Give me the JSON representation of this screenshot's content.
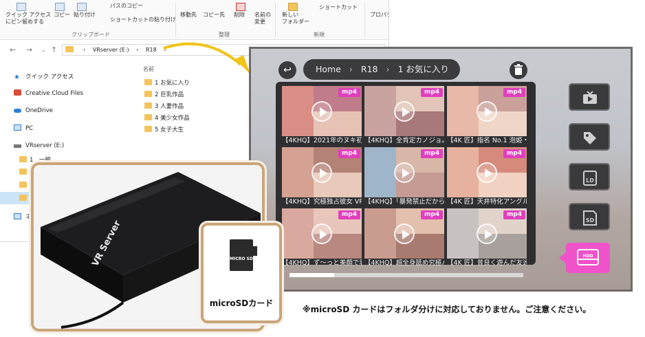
{
  "explorer": {
    "ribbon": {
      "pin_label": "クイック アクセス\nにピン留めする",
      "copy": "コピー",
      "paste": "貼り付け",
      "copy_path": "パスのコピー",
      "paste_shortcut": "ショートカットの貼り付け",
      "clipboard_group": "クリップボード",
      "move_to": "移動先",
      "copy_to": "コピー先",
      "delete": "削除",
      "rename": "名前の\n変更",
      "organize_group": "整理",
      "new_folder": "新しい\nフォルダー",
      "shortcut": "ショートカット",
      "new_group": "新規",
      "properties": "プロパティ"
    },
    "address": {
      "crumb_1": "VRserver (E:)",
      "crumb_2": "R18",
      "sep": "›"
    },
    "nav": {
      "quick_access": "クイック アクセス",
      "creative_cloud": "Creative Cloud Files",
      "onedrive": "OneDrive",
      "pc": "PC",
      "vrserver": "VRserver (E:)",
      "folder_1": "1　一般",
      "folder_a": "A",
      "folder_l": "L",
      "folder_p": "P",
      "network": "ネ"
    },
    "column_name": "名前",
    "files": [
      "1 お気に入り",
      "2 巨乳作品",
      "3 人妻作品",
      "4 美少女作品",
      "5 女子大生"
    ]
  },
  "vr": {
    "breadcrumb": [
      "Home",
      "R18",
      "1 お気に入り"
    ],
    "breadcrumb_sep": "›",
    "badge": "mp4",
    "videos": [
      {
        "title": "【4KHQ】2021年のヌキ初め",
        "colors": [
          "#d98f86",
          "#c07c8a",
          "#e7c3b6"
        ]
      },
      {
        "title": "【4KHQ】全肯定カノジョ。",
        "colors": [
          "#c9a3a0",
          "#e2c5b8",
          "#a9787a"
        ]
      },
      {
        "title": "【4K 匠】指名 No.1 泡姫・",
        "colors": [
          "#e8b8a8",
          "#caa09a",
          "#f0d6c8"
        ]
      },
      {
        "title": "【4KHQ】究極独占彼女 VR",
        "colors": [
          "#d4a193",
          "#b48276",
          "#e9c9ba"
        ]
      },
      {
        "title": "【4KHQ】「暴発禁止だから",
        "colors": [
          "#9fb5c9",
          "#d8b7a8",
          "#c49a92"
        ]
      },
      {
        "title": "【4K 匠】天井特化アングル",
        "colors": [
          "#e6b29f",
          "#d68a7c",
          "#f2d2c2"
        ]
      },
      {
        "title": "【4KHQ】ず〜っと美顔で乳",
        "colors": [
          "#d9a9a0",
          "#e8c6bc",
          "#b98881"
        ]
      },
      {
        "title": "【4KHQ】超全身舐め究極ハ",
        "colors": [
          "#c99c8f",
          "#e3bfae",
          "#a87a70"
        ]
      },
      {
        "title": "【4K 匠】昔良く遊んだ友達",
        "colors": [
          "#c8c3c0",
          "#e2d3ca",
          "#a7a09c"
        ]
      }
    ],
    "side_buttons": [
      "tv-icon",
      "tag-icon",
      "ld-icon",
      "sd-icon"
    ],
    "sd_label": "SD",
    "ld_label": "LD",
    "hdd_label": "HDD",
    "scroll_progress": 0.19
  },
  "products": {
    "hdd_brand": "VR Server",
    "sd_card_label": "microSDカード",
    "sd_chip_text": "MICRO SD"
  },
  "note": "※microSD カードはフォルダ分けに対応しておりません。ご注意ください。",
  "colors": {
    "accent_pink": "#e03fbd",
    "hdd_button": "#f052c9",
    "card_border": "#c9a57a",
    "panel_dark": "#2f2f31"
  }
}
